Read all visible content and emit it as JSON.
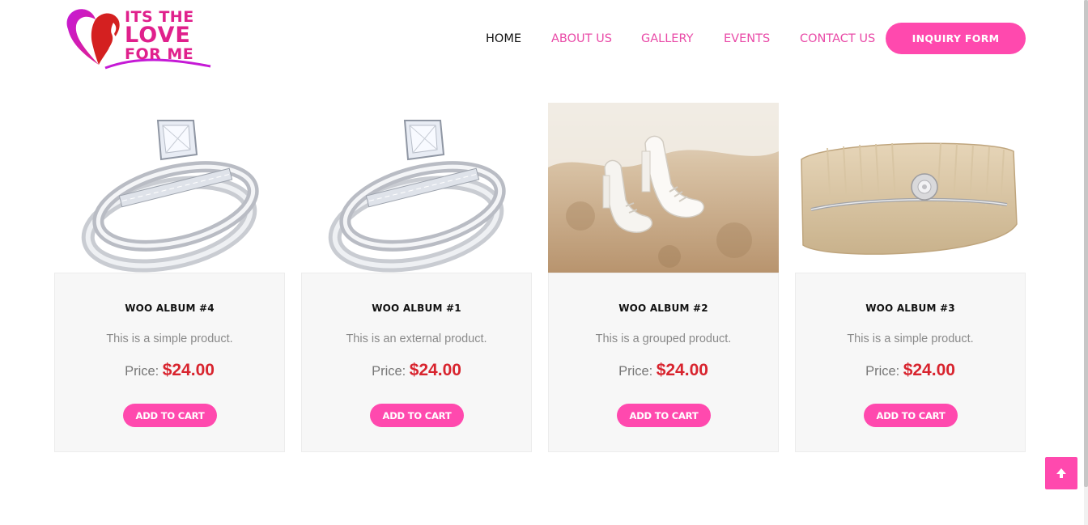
{
  "logo": {
    "line1": "ITS THE",
    "line2": "LOVE",
    "line3": "FOR ME"
  },
  "nav": {
    "items": [
      {
        "label": "HOME",
        "active": true
      },
      {
        "label": "ABOUT US",
        "active": false
      },
      {
        "label": "GALLERY",
        "active": false
      },
      {
        "label": "EVENTS",
        "active": false
      },
      {
        "label": "CONTACT US",
        "active": false
      }
    ],
    "cta_label": "INQUIRY FORM"
  },
  "products": [
    {
      "title": "WOO ALBUM #4",
      "description": "This is a simple product.",
      "price_label": "Price:",
      "price": "$24.00",
      "button_label": "ADD TO CART",
      "image": "ring"
    },
    {
      "title": "WOO ALBUM #1",
      "description": "This is an external product.",
      "price_label": "Price:",
      "price": "$24.00",
      "button_label": "ADD TO CART",
      "image": "ring"
    },
    {
      "title": "WOO ALBUM #2",
      "description": "This is a grouped product.",
      "price_label": "Price:",
      "price": "$24.00",
      "button_label": "ADD TO CART",
      "image": "shoes"
    },
    {
      "title": "WOO ALBUM #3",
      "description": "This is a simple product.",
      "price_label": "Price:",
      "price": "$24.00",
      "button_label": "ADD TO CART",
      "image": "clutch"
    }
  ],
  "colors": {
    "accent": "#ff49ae",
    "nav_text": "#e94aa7",
    "price": "#d8242e"
  },
  "icons": {
    "scroll_top": "arrow-up-icon",
    "logo": "woman-heart-logo-icon"
  }
}
